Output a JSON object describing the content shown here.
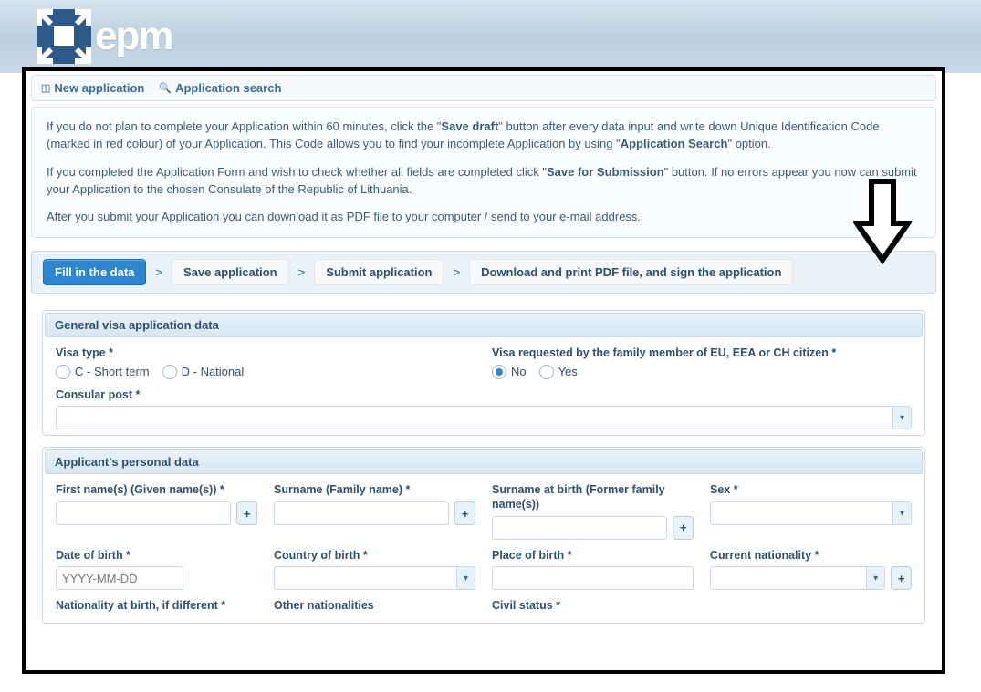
{
  "brand": {
    "name": "epm"
  },
  "top_links": {
    "new_application": "New application",
    "application_search": "Application search"
  },
  "info": {
    "p1_pre": "If you do not plan to complete your Application within 60 minutes, click the \"",
    "p1_b1": "Save draft",
    "p1_mid": "\" button after every data input and write down Unique Identification Code (marked in red colour) of your Application. This Code allows you to find your incomplete Application by using \"",
    "p1_b2": "Application Search",
    "p1_end": "\" option.",
    "p2_pre": "If you completed the Application Form and wish to check whether all fields are completed click \"",
    "p2_b1": "Save for Submission",
    "p2_end": "\" button. If no errors appear you now can submit your Application to the chosen Consulate of the Republic of Lithuania.",
    "p3": "After you submit your Application you can download it as PDF file to your computer / send to your e-mail address."
  },
  "steps": {
    "fill": "Fill in the data",
    "save": "Save application",
    "submit": "Submit application",
    "download": "Download and print PDF file, and sign the application",
    "sep": ">"
  },
  "section_general": {
    "title": "General visa application data",
    "visa_type_label": "Visa type *",
    "visa_type_c": "C - Short term",
    "visa_type_d": "D - National",
    "family_member_label": "Visa requested by the family member of EU, EEA or CH citizen *",
    "no": "No",
    "yes": "Yes",
    "consular_post_label": "Consular post *"
  },
  "section_personal": {
    "title": "Applicant's personal data",
    "first_name": "First name(s) (Given name(s)) *",
    "surname": "Surname (Family name) *",
    "surname_birth": "Surname at birth (Former family name(s))",
    "sex": "Sex *",
    "dob": "Date of birth *",
    "dob_placeholder": "YYYY-MM-DD",
    "country_birth": "Country of birth *",
    "place_birth": "Place of birth *",
    "current_nationality": "Current nationality *",
    "nationality_birth": "Nationality at birth, if different *",
    "other_nationalities": "Other nationalities",
    "civil_status": "Civil status *"
  }
}
